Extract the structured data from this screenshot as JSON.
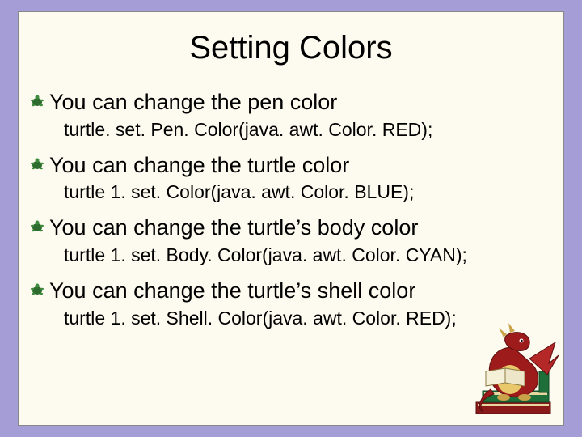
{
  "slide": {
    "title": "Setting Colors",
    "items": [
      {
        "lead": "You can change the pen color",
        "code": "turtle. set. Pen. Color(java. awt. Color. RED);"
      },
      {
        "lead": "You can change the turtle color",
        "code": "turtle 1. set. Color(java. awt. Color. BLUE);"
      },
      {
        "lead": "You can change the turtle’s body color",
        "code": "turtle 1. set. Body. Color(java. awt. Color. CYAN);"
      },
      {
        "lead": "You can change the turtle’s shell color",
        "code": "turtle 1. set. Shell. Color(java. awt. Color. RED);"
      }
    ]
  }
}
